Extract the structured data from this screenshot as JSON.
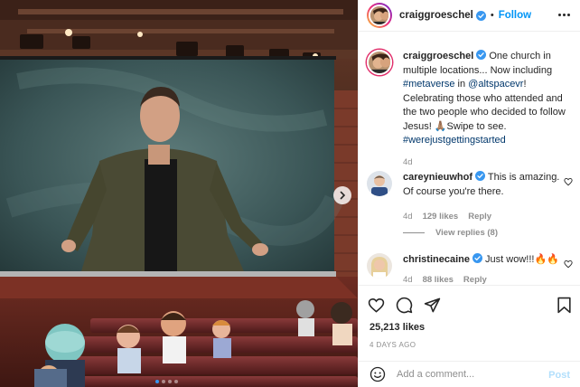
{
  "post": {
    "author": "craiggroeschel",
    "follow_label": "Follow",
    "separator": "•",
    "caption": {
      "text_1": "One church in multiple locations... Now including ",
      "hashtag_1": "#metaverse",
      "text_2": " in ",
      "mention": "@altspacevr",
      "text_3": "! Celebrating those who attended and the two people who decided to follow Jesus! 🙏🏽Swipe to see.",
      "hashtag_2": "#werejustgettingstarted"
    },
    "caption_age": "4d",
    "likes": "25,213 likes",
    "date": "4 DAYS AGO",
    "comment_placeholder": "Add a comment...",
    "post_label": "Post"
  },
  "comments": [
    {
      "username": "careynieuwhof",
      "text": "This is amazing. Of course you're there.",
      "age": "4d",
      "likes": "129 likes",
      "reply_label": "Reply",
      "view_replies": "View replies (8)"
    },
    {
      "username": "christinecaine",
      "text": "Just wow!!!🔥🔥",
      "age": "4d",
      "likes": "88 likes",
      "reply_label": "Reply"
    }
  ],
  "carousel": {
    "slide_count": 4,
    "active_index": 0
  },
  "icons": {
    "verified": "verified-badge-icon",
    "like": "heart-icon",
    "comment": "comment-bubble-icon",
    "share": "paper-plane-icon",
    "save": "bookmark-icon",
    "emoji": "smiley-icon",
    "next": "chevron-right-icon"
  },
  "colors": {
    "accent": "#0095f6",
    "verified": "#3897f0",
    "link": "#00376b",
    "muted": "#8e8e8e",
    "post_disabled": "#b2dffc"
  }
}
